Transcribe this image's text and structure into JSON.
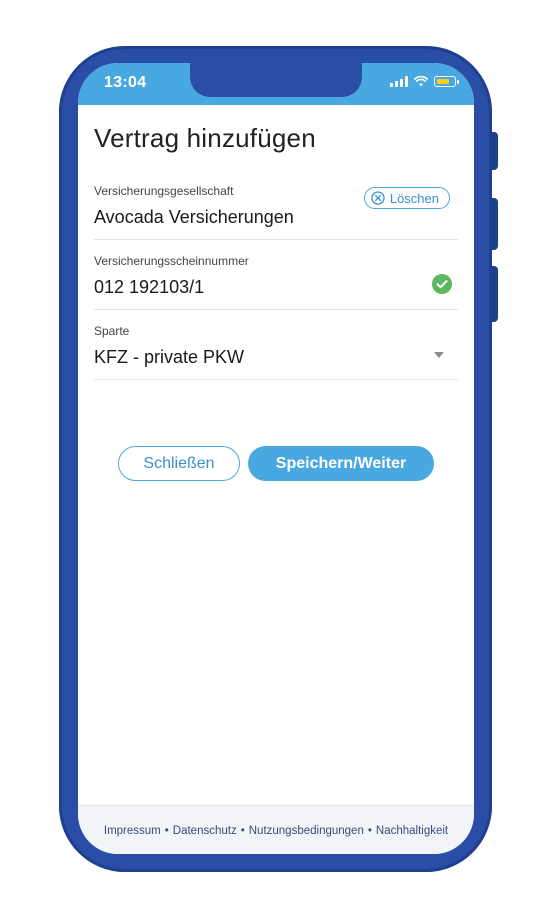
{
  "statusbar": {
    "time": "13:04"
  },
  "page": {
    "title": "Vertrag hinzufügen"
  },
  "fields": {
    "company": {
      "label": "Versicherungsgesellschaft",
      "value": "Avocada Versicherungen",
      "clear_label": "Löschen"
    },
    "policy": {
      "label": "Versicherungsscheinnummer",
      "value": "012 192103/1"
    },
    "division": {
      "label": "Sparte",
      "value": "KFZ - private PKW"
    }
  },
  "actions": {
    "close_label": "Schließen",
    "save_label": "Speichern/Weiter"
  },
  "footer": {
    "links": [
      "Impressum",
      "Datenschutz",
      "Nutzungsbedingungen",
      "Nachhaltigkeit"
    ],
    "separator": "•"
  },
  "colors": {
    "accent": "#4aa8e0",
    "frame": "#2a4ea6",
    "success": "#5cb85c",
    "battery": "#f5d21a"
  },
  "icons": {
    "clear": "close-circle-icon",
    "valid": "check-circle-icon",
    "dropdown": "caret-down-icon"
  }
}
